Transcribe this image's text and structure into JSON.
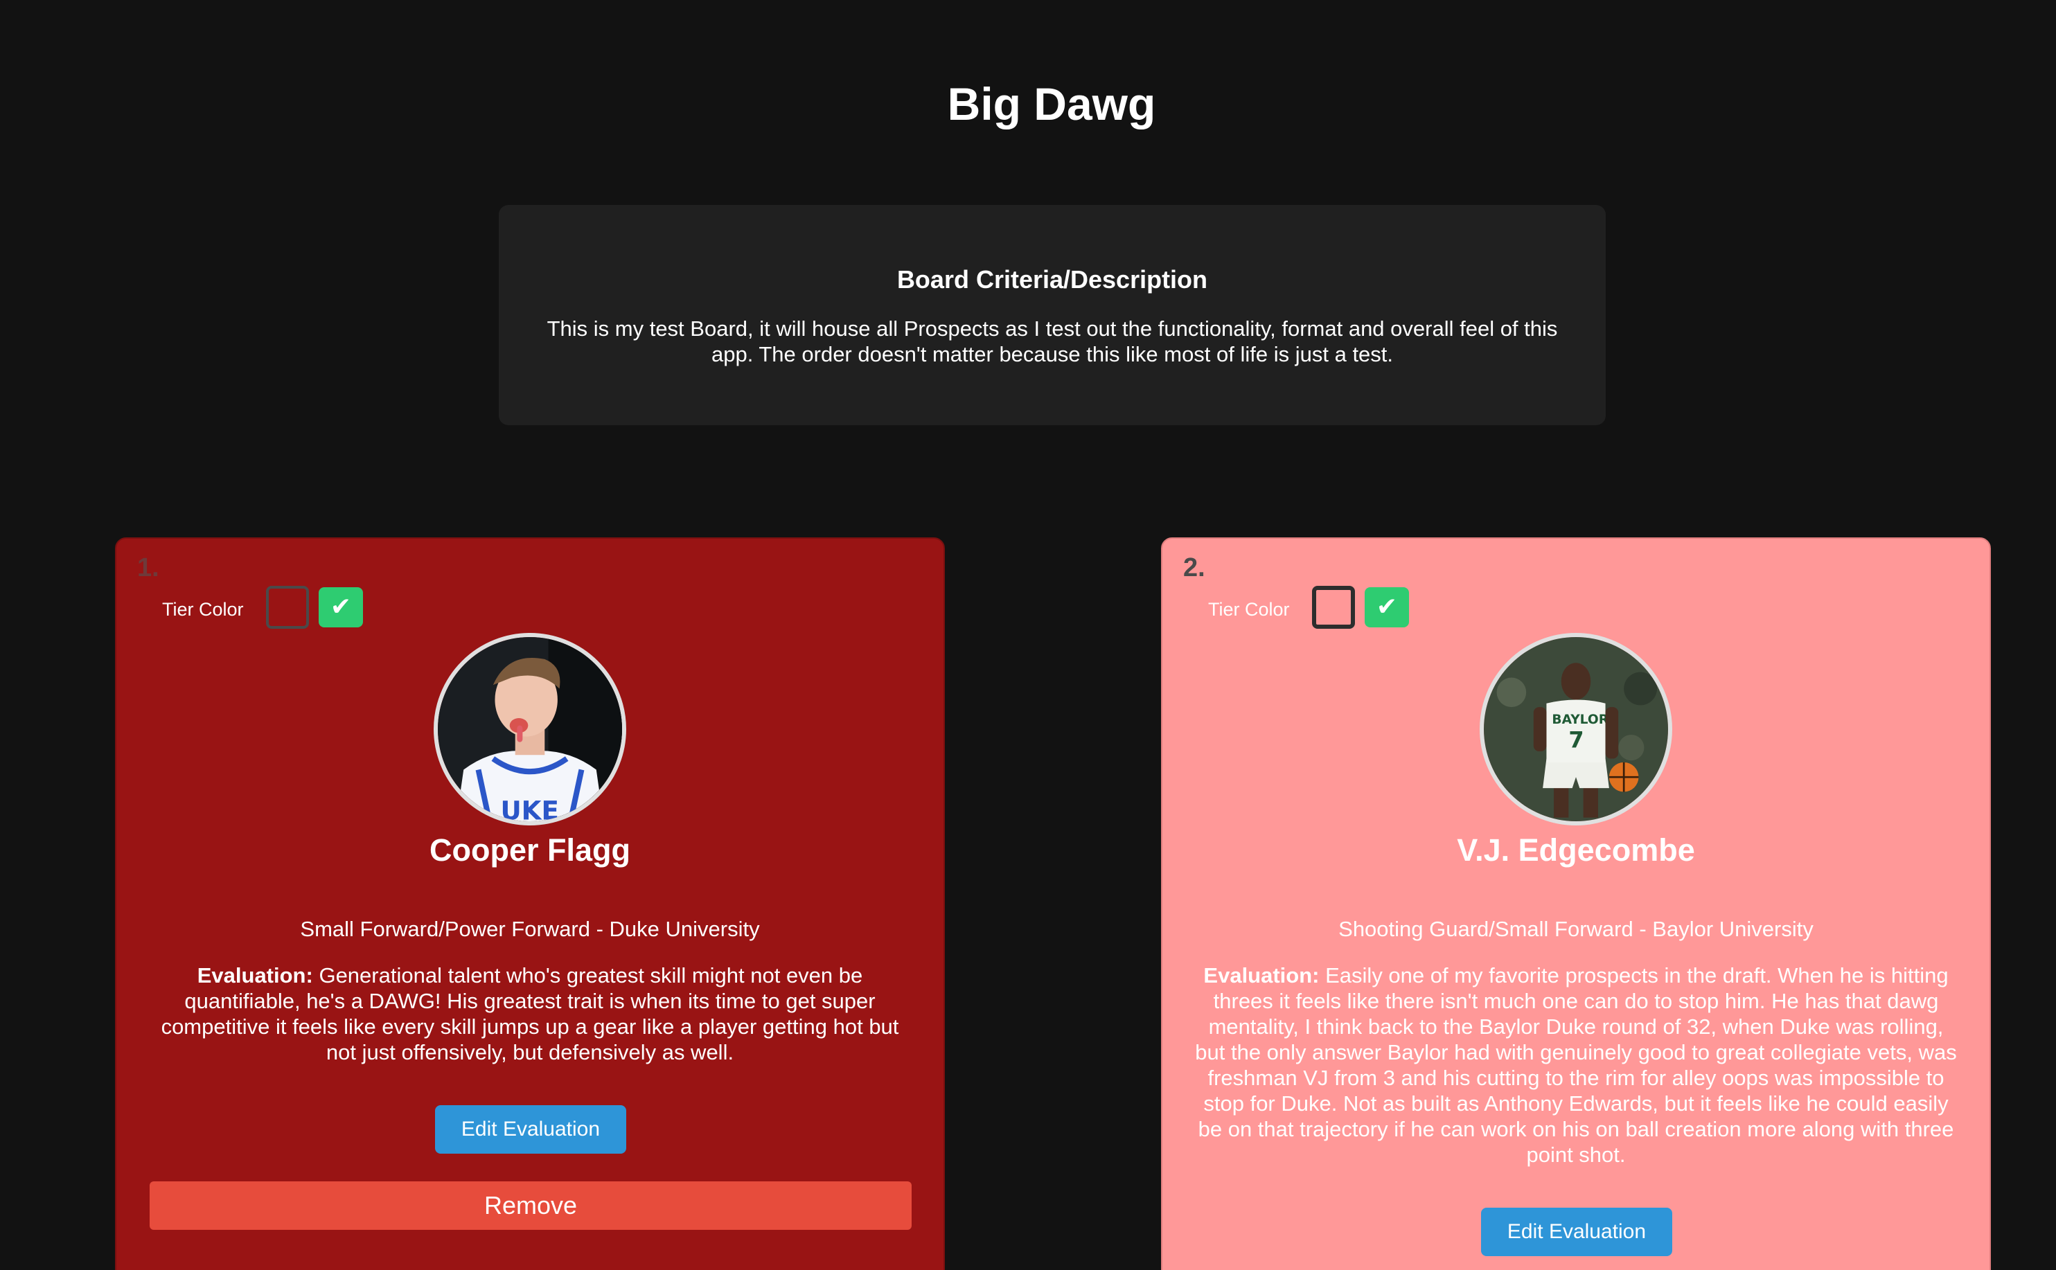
{
  "board": {
    "title": "Big Dawg",
    "criteria_heading": "Board Criteria/Description",
    "criteria_text": "This is my test Board, it will house all Prospects as I test out the functionality, format and overall feel of this app. The order doesn't matter because this like most of life is just a test."
  },
  "prospects": [
    {
      "rank": "1.",
      "tier_label": "Tier Color",
      "tier_color": "#991414",
      "confirm_icon": "✔",
      "name": "Cooper Flagg",
      "position": "Small Forward/Power Forward - Duke University",
      "evaluation_label": "Evaluation:",
      "evaluation_text": "Generational talent who's greatest skill might not even be quantifiable, he's a DAWG! His greatest trait is when its time to get super competitive it feels like every skill jumps up a gear like a player getting hot but not just offensively, but defensively as well.",
      "edit_label": "Edit Evaluation",
      "remove_label": "Remove"
    },
    {
      "rank": "2.",
      "tier_label": "Tier Color",
      "tier_color": "#ff9898",
      "confirm_icon": "✔",
      "name": "V.J. Edgecombe",
      "position": "Shooting Guard/Small Forward - Baylor University",
      "evaluation_label": "Evaluation:",
      "evaluation_text": "Easily one of my favorite prospects in the draft. When he is hitting threes it feels like there isn't much one can do to stop him. He has that dawg mentality, I think back to the Baylor Duke round of 32, when Duke was rolling, but the only answer Baylor had with genuinely good to great collegiate vets, was freshman VJ from 3 and his cutting to the rim for alley oops was impossible to stop for Duke. Not as built as Anthony Edwards, but it feels like he could easily be on that trajectory if he can work on his on ball creation more along with three point shot.",
      "edit_label": "Edit Evaluation"
    }
  ],
  "colors": {
    "page_background": "#121212",
    "criteria_background": "#202020",
    "confirm_green": "#2ecc71",
    "edit_blue": "#2e95d8",
    "remove_red": "#e74c3c"
  }
}
